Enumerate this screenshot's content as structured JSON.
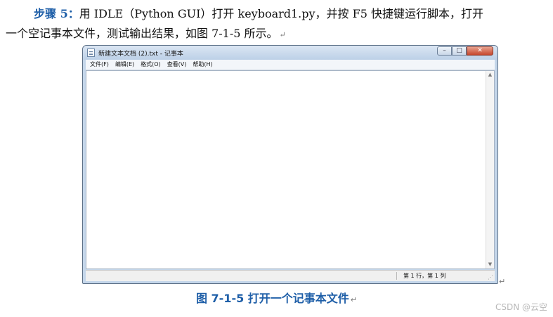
{
  "paragraph": {
    "step_label": "步骤 5：",
    "line1_text": "用 IDLE（Python GUI）打开 keyboard1.py，并按 F5 快捷键运行脚本，打开",
    "line2_text": "一个空记事本文件，测试输出结果，如图 7-1-5 所示。",
    "return_mark": "↵"
  },
  "notepad": {
    "window_title": "新建文本文档 (2).txt - 记事本",
    "menu": [
      "文件(F)",
      "编辑(E)",
      "格式(O)",
      "查看(V)",
      "帮助(H)"
    ],
    "content": "",
    "status_position": "第 1 行，第 1 列",
    "controls": {
      "minimize": "–",
      "maximize": "□",
      "close": "✕"
    }
  },
  "figure": {
    "caption": "图  7-1-5  打开一个记事本文件",
    "return_mark": "↵"
  },
  "watermark": "CSDN @云空",
  "colors": {
    "heading_blue": "#1f5fa8",
    "close_red": "#c6482e"
  }
}
